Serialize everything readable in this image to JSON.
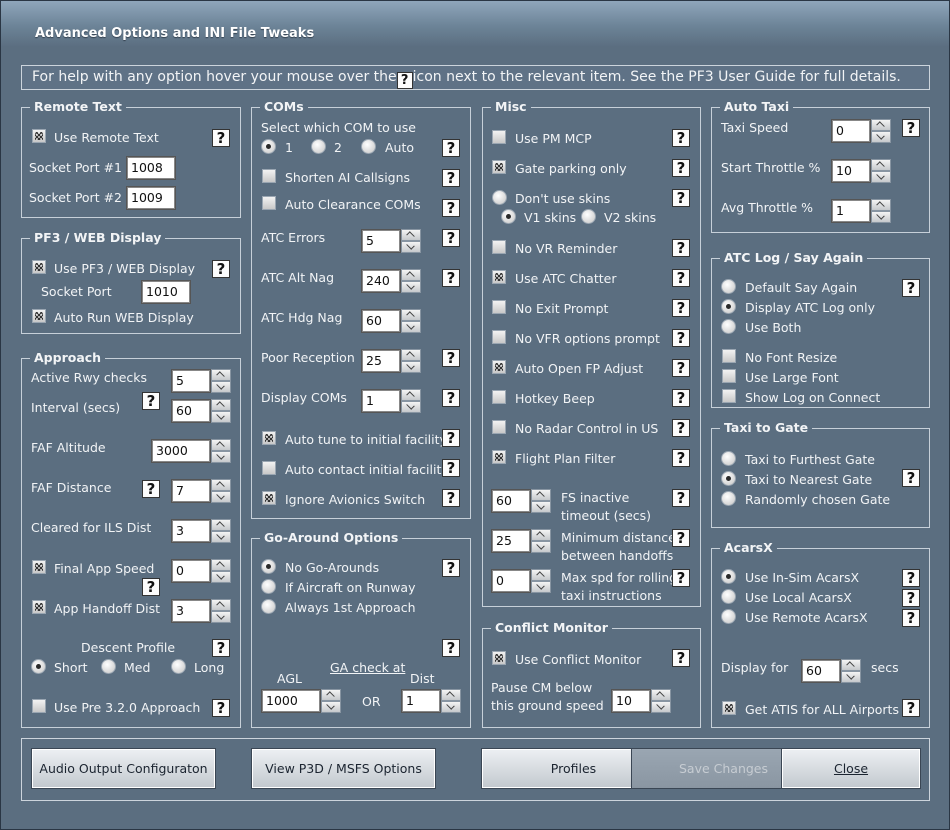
{
  "window": {
    "title": "Advanced Options and INI File Tweaks"
  },
  "help": {
    "before": "For help with any option hover your mouse over the",
    "icon": "?",
    "after": "icon next to the relevant item. See the PF3 User Guide for full details."
  },
  "help_glyph": "?",
  "remote_text": {
    "title": "Remote Text",
    "use_label": "Use Remote Text",
    "use_checked": true,
    "port1_label": "Socket Port #1",
    "port1_value": "1008",
    "port2_label": "Socket Port #2",
    "port2_value": "1009"
  },
  "pf3_web": {
    "title": "PF3 / WEB Display",
    "use_label": "Use PF3 / WEB Display",
    "use_checked": true,
    "port_label": "Socket Port",
    "port_value": "1010",
    "auto_label": "Auto Run WEB Display",
    "auto_checked": true
  },
  "approach": {
    "title": "Approach",
    "active_rwy_label": "Active Rwy checks",
    "active_rwy_value": "5",
    "interval_label": "Interval (secs)",
    "interval_value": "60",
    "faf_alt_label": "FAF Altitude",
    "faf_alt_value": "3000",
    "faf_dist_label": "FAF Distance",
    "faf_dist_value": "7",
    "ils_label": "Cleared for ILS Dist",
    "ils_value": "3",
    "final_label": "Final App Speed",
    "final_checked": true,
    "final_value": "0",
    "handoff_label": "App Handoff Dist",
    "handoff_checked": true,
    "handoff_value": "3",
    "descent_label": "Descent Profile",
    "short_label": "Short",
    "med_label": "Med",
    "long_label": "Long",
    "descent_selected": "Short",
    "pre_label": "Use Pre 3.2.0 Approach",
    "pre_checked": false
  },
  "coms": {
    "title": "COMs",
    "select_label": "Select which COM to use",
    "opt1": "1",
    "opt2": "2",
    "opt_auto": "Auto",
    "selected": "1",
    "shorten_label": "Shorten AI Callsigns",
    "shorten_checked": false,
    "autoclear_label": "Auto Clearance COMs",
    "autoclear_checked": false,
    "errors_label": "ATC Errors",
    "errors_value": "5",
    "altnag_label": "ATC Alt Nag",
    "altnag_value": "240",
    "hdgnag_label": "ATC Hdg Nag",
    "hdgnag_value": "60",
    "poor_label": "Poor Reception",
    "poor_value": "25",
    "display_label": "Display COMs",
    "display_value": "1",
    "autotune_label": "Auto tune to initial facility",
    "autotune_checked": true,
    "autocontact_label": "Auto contact initial facility",
    "autocontact_checked": false,
    "ignore_label": "Ignore Avionics Switch",
    "ignore_checked": true
  },
  "go_around": {
    "title": "Go-Around Options",
    "none_label": "No Go-Arounds",
    "runway_label": "If Aircraft on Runway",
    "always_label": "Always 1st Approach",
    "selected": "No Go-Arounds",
    "ga_check_label": "GA check at",
    "agl_label": "AGL",
    "agl_value": "1000",
    "or_label": "OR",
    "dist_label": "Dist",
    "dist_value": "1"
  },
  "misc": {
    "title": "Misc",
    "pm_mcp": "Use PM MCP",
    "pm_mcp_checked": false,
    "gate_parking": "Gate parking only",
    "gate_parking_checked": true,
    "dont_skins": "Don't use skins",
    "v1_skins": "V1 skins",
    "v2_skins": "V2 skins",
    "skins_selected": "V1 skins",
    "no_vr": "No VR Reminder",
    "no_vr_checked": false,
    "chatter": "Use ATC Chatter",
    "chatter_checked": true,
    "no_exit": "No Exit Prompt",
    "no_exit_checked": false,
    "no_vfr": "No VFR options  prompt",
    "no_vfr_checked": false,
    "auto_fp": "Auto Open FP Adjust",
    "auto_fp_checked": true,
    "hotkey": "Hotkey Beep",
    "hotkey_checked": false,
    "no_radar": "No Radar Control in US",
    "no_radar_checked": false,
    "fp_filter": "Flight Plan Filter",
    "fp_filter_checked": true,
    "fs_inactive_value": "60",
    "fs_inactive_label1": "FS inactive",
    "fs_inactive_label2": "timeout (secs)",
    "min_dist_value": "25",
    "min_dist_label1": "Minimum distance",
    "min_dist_label2": "between handoffs",
    "max_spd_value": "0",
    "max_spd_label1": "Max spd for rolling",
    "max_spd_label2": "taxi instructions"
  },
  "conflict": {
    "title": "Conflict Monitor",
    "use_label": "Use Conflict Monitor",
    "use_checked": true,
    "pause_label1": "Pause CM below",
    "pause_label2": "this ground speed",
    "pause_value": "10"
  },
  "auto_taxi": {
    "title": "Auto Taxi",
    "speed_label": "Taxi Speed",
    "speed_value": "0",
    "start_label": "Start Throttle %",
    "start_value": "10",
    "avg_label": "Avg Throttle  %",
    "avg_value": "1"
  },
  "atc_log": {
    "title": "ATC Log / Say Again",
    "default_label": "Default Say Again",
    "display_label": "Display ATC Log only",
    "both_label": "Use Both",
    "selected": "Display ATC Log only",
    "no_resize": "No Font Resize",
    "no_resize_checked": false,
    "large_font": "Use Large Font",
    "large_font_checked": false,
    "show_log": "Show Log on Connect",
    "show_log_checked": false
  },
  "taxi_gate": {
    "title": "Taxi to Gate",
    "furthest": "Taxi to Furthest Gate",
    "nearest": "Taxi to Nearest Gate",
    "random": "Randomly chosen Gate",
    "selected": "Taxi to Nearest Gate"
  },
  "acarsx": {
    "title": "AcarsX",
    "insim": "Use In-Sim AcarsX",
    "local": "Use Local AcarsX",
    "remote": "Use Remote AcarsX",
    "selected": "Use In-Sim AcarsX",
    "display_for": "Display for",
    "display_value": "60",
    "secs": "secs",
    "atis_label": "Get ATIS for ALL Airports",
    "atis_checked": true
  },
  "buttons": {
    "audio": "Audio Output Configuraton",
    "view": "View P3D / MSFS Options",
    "profiles": "Profiles",
    "save": "Save Changes",
    "close": "Close"
  },
  "colors": {
    "panel": "#5b6e80",
    "titlebar": "#7a90a4",
    "border": "#c7d0d9",
    "button": "#e4e8ec"
  }
}
